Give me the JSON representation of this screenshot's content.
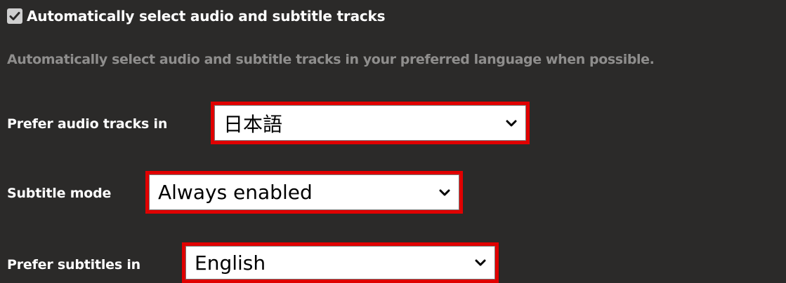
{
  "auto_select": {
    "checked": true,
    "label": "Automatically select audio and subtitle tracks",
    "description": "Automatically select audio and subtitle tracks in your preferred language when possible."
  },
  "audio_language": {
    "label": "Prefer audio tracks in",
    "value": "日本語"
  },
  "subtitle_mode": {
    "label": "Subtitle mode",
    "value": "Always enabled"
  },
  "subtitle_language": {
    "label": "Prefer subtitles in",
    "value": "English"
  },
  "colors": {
    "background": "#2b2a29",
    "highlight": "#e00000",
    "description_text": "#8f8e8d"
  },
  "icons": [
    "checkmark-icon",
    "chevron-down-icon"
  ]
}
